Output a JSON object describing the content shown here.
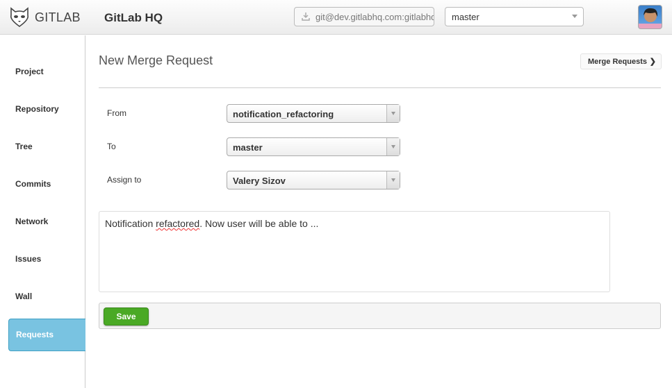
{
  "header": {
    "logo_text": "GITLAB",
    "project": "GitLab HQ",
    "clone_url": "git@dev.gitlabhq.com:gitlabhq.git",
    "branch": "master"
  },
  "sidebar": {
    "items": [
      {
        "label": "Project"
      },
      {
        "label": "Repository"
      },
      {
        "label": "Tree"
      },
      {
        "label": "Commits"
      },
      {
        "label": "Network"
      },
      {
        "label": "Issues"
      },
      {
        "label": "Wall"
      },
      {
        "label": "Requests"
      }
    ]
  },
  "main": {
    "title": "New Merge Request",
    "merge_requests_button": "Merge Requests",
    "form": {
      "from_label": "From",
      "from_value": "notification_refactoring",
      "to_label": "To",
      "to_value": "master",
      "assign_label": "Assign to",
      "assign_value": "Valery Sizov",
      "description_pre": "Notification ",
      "description_misspelled": "refactored",
      "description_post": ". Now user will be able to ..."
    },
    "save_label": "Save"
  },
  "colors": {
    "accent": "#79c3e1",
    "save": "#4aa925"
  }
}
